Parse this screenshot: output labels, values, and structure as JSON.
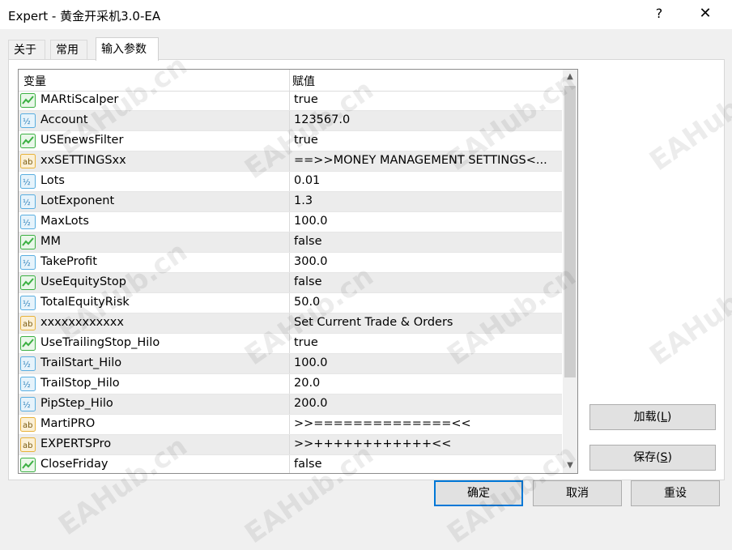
{
  "window": {
    "title": "Expert - 黄金开采机3.0-EA",
    "help_label": "?",
    "close_label": "✕"
  },
  "tabs": [
    {
      "label": "关于"
    },
    {
      "label": "常用"
    },
    {
      "label": "输入参数"
    }
  ],
  "table": {
    "columns": {
      "variable": "变量",
      "value": "赋值"
    },
    "rows": [
      {
        "icon": "bool-icon",
        "name": "MARtiScalper",
        "value": "true"
      },
      {
        "icon": "number-icon",
        "name": "Account",
        "value": "123567.0"
      },
      {
        "icon": "bool-icon",
        "name": "USEnewsFilter",
        "value": "true"
      },
      {
        "icon": "string-icon",
        "name": "xxSETTINGSxx",
        "value": "==>>MONEY MANAGEMENT SETTINGS<..."
      },
      {
        "icon": "number-icon",
        "name": "Lots",
        "value": "0.01"
      },
      {
        "icon": "number-icon",
        "name": "LotExponent",
        "value": "1.3"
      },
      {
        "icon": "number-icon",
        "name": "MaxLots",
        "value": "100.0"
      },
      {
        "icon": "bool-icon",
        "name": "MM",
        "value": "false"
      },
      {
        "icon": "number-icon",
        "name": "TakeProfit",
        "value": "300.0"
      },
      {
        "icon": "bool-icon",
        "name": "UseEquityStop",
        "value": "false"
      },
      {
        "icon": "number-icon",
        "name": "TotalEquityRisk",
        "value": "50.0"
      },
      {
        "icon": "string-icon",
        "name": "xxxxxxxxxxxx",
        "value": "Set Current Trade & Orders"
      },
      {
        "icon": "bool-icon",
        "name": "UseTrailingStop_Hilo",
        "value": "true"
      },
      {
        "icon": "number-icon",
        "name": "TrailStart_Hilo",
        "value": "100.0"
      },
      {
        "icon": "number-icon",
        "name": "TrailStop_Hilo",
        "value": "20.0"
      },
      {
        "icon": "number-icon",
        "name": "PipStep_Hilo",
        "value": "200.0"
      },
      {
        "icon": "string-icon",
        "name": "MartiPRO",
        "value": ">>==============<<"
      },
      {
        "icon": "string-icon",
        "name": "EXPERTSPro",
        "value": ">>++++++++++++<<"
      },
      {
        "icon": "bool-icon",
        "name": "CloseFriday",
        "value": "false"
      }
    ]
  },
  "side_buttons": {
    "load": {
      "label": "加载(",
      "key": "L",
      "end": ")"
    },
    "save": {
      "label": "保存(",
      "key": "S",
      "end": ")"
    }
  },
  "footer_buttons": {
    "ok": "确定",
    "cancel": "取消",
    "reset": "重设"
  },
  "watermark": "EAHub.cn",
  "colors": {
    "bool_icon": "#3cb043",
    "number_icon": "#5aaee0",
    "string_icon": "#e8b23a",
    "default_button_border": "#0078d7"
  }
}
